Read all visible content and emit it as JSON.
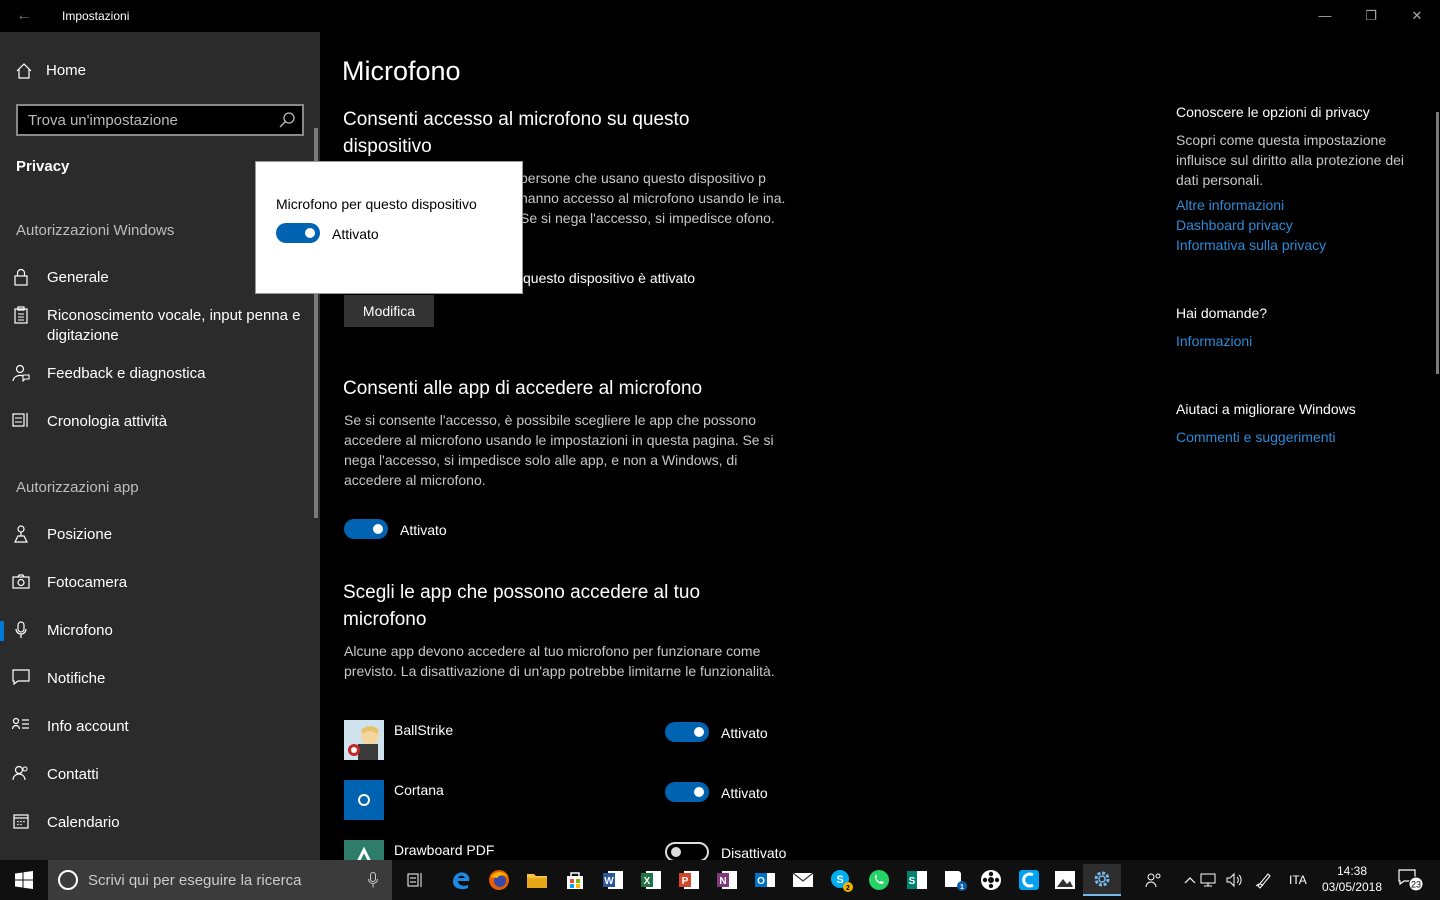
{
  "window": {
    "title": "Impostazioni"
  },
  "sidebar": {
    "home_label": "Home",
    "search_placeholder": "Trova un'impostazione",
    "section": "Privacy",
    "group_windows": "Autorizzazioni Windows",
    "group_app": "Autorizzazioni app",
    "items": [
      {
        "label": "Generale",
        "icon": "lock-icon"
      },
      {
        "label": "Riconoscimento vocale, input penna e digitazione",
        "icon": "clipboard-icon"
      },
      {
        "label": "Feedback e diagnostica",
        "icon": "feedback-icon"
      },
      {
        "label": "Cronologia attività",
        "icon": "timeline-icon"
      },
      {
        "label": "Posizione",
        "icon": "location-icon"
      },
      {
        "label": "Fotocamera",
        "icon": "camera-icon"
      },
      {
        "label": "Microfono",
        "icon": "microphone-icon",
        "active": true
      },
      {
        "label": "Notifiche",
        "icon": "notification-icon"
      },
      {
        "label": "Info account",
        "icon": "account-info-icon"
      },
      {
        "label": "Contatti",
        "icon": "contacts-icon"
      },
      {
        "label": "Calendario",
        "icon": "calendar-icon"
      }
    ]
  },
  "flyout": {
    "title": "Microfono per questo dispositivo",
    "state": "Attivato",
    "on": true
  },
  "main": {
    "title": "Microfono",
    "section1": {
      "heading": "Consenti accesso al microfono su questo dispositivo",
      "desc_partial": "persone che usano questo dispositivo p hanno accesso al microfono usando le ina. Se si nega l'accesso, si impedisce ofono.",
      "status_partial": "questo dispositivo è attivato",
      "button": "Modifica"
    },
    "section2": {
      "heading": "Consenti alle app di accedere al microfono",
      "desc": "Se si consente l'accesso, è possibile scegliere le app che possono accedere al microfono usando le impostazioni in questa pagina. Se si nega l'accesso, si impedisce solo alle app, e non a Windows, di accedere al microfono.",
      "toggle_state": "Attivato",
      "on": true
    },
    "section3": {
      "heading": "Scegli le app che possono accedere al tuo microfono",
      "desc": "Alcune app devono accedere al tuo microfono per funzionare come previsto. La disattivazione di un'app potrebbe limitarne le funzionalità.",
      "apps": [
        {
          "name": "BallStrike",
          "state": "Attivato",
          "on": true
        },
        {
          "name": "Cortana",
          "state": "Attivato",
          "on": true
        },
        {
          "name": "Drawboard PDF",
          "state": "Disattivato",
          "on": false
        }
      ]
    }
  },
  "right_panel": {
    "privacy_heading": "Conoscere le opzioni di privacy",
    "privacy_text": "Scopri come questa impostazione influisce sul diritto alla protezione dei dati personali.",
    "links": [
      "Altre informazioni",
      "Dashboard privacy",
      "Informativa sulla privacy"
    ],
    "questions_heading": "Hai domande?",
    "questions_link": "Informazioni",
    "improve_heading": "Aiutaci a migliorare Windows",
    "improve_link": "Commenti e suggerimenti"
  },
  "taskbar": {
    "search_placeholder": "Scrivi qui per eseguire la ricerca",
    "language": "ITA",
    "time": "14:38",
    "date": "03/05/2018",
    "notification_count": "23",
    "skype_badge": "2",
    "outlook_badge": "1"
  },
  "colors": {
    "accent": "#0078d7",
    "toggle_on": "#0063b1",
    "link": "#2d8ad6",
    "sidebar_bg": "#2b2b2b"
  }
}
